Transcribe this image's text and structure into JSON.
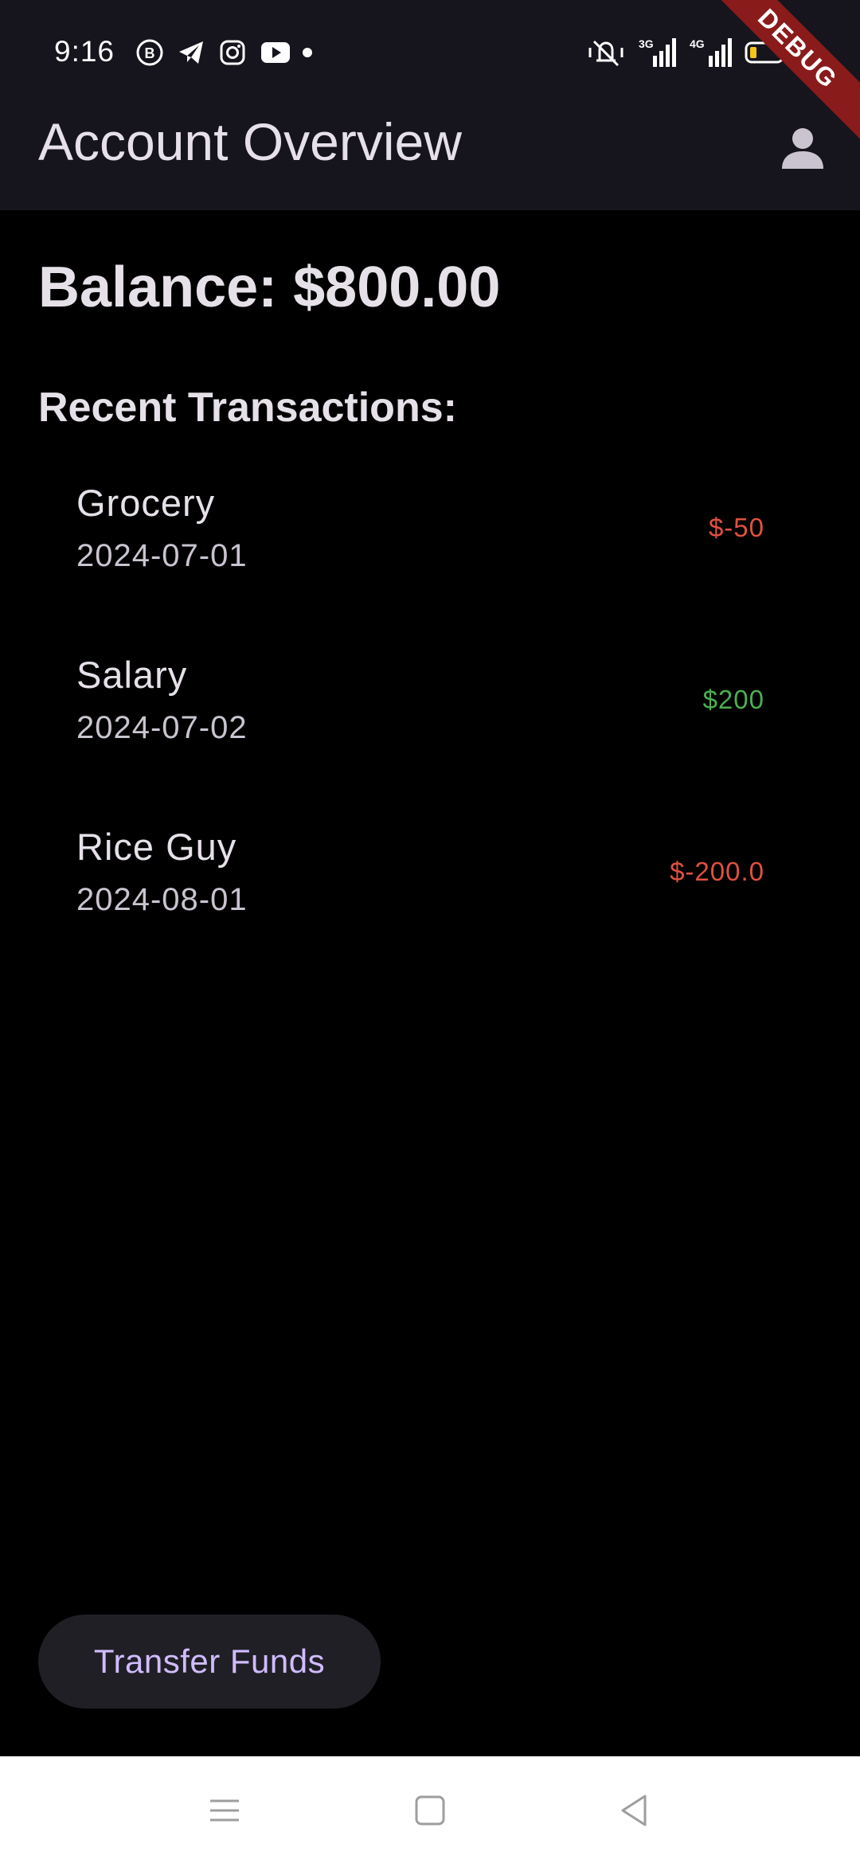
{
  "status_bar": {
    "time": "9:16",
    "notification_icons": [
      "b-icon",
      "telegram-icon",
      "instagram-icon",
      "youtube-icon",
      "dot-icon"
    ],
    "system_icons": [
      "vibrate-icon",
      "signal-3g-icon",
      "signal-4g-icon",
      "battery-icon"
    ],
    "network_labels": [
      "3G",
      "4G"
    ]
  },
  "debug_banner": "DEBUG",
  "app_bar": {
    "title": "Account Overview",
    "profile_icon": "person-icon"
  },
  "balance_text": "Balance: $800.00",
  "recent_heading": "Recent Transactions:",
  "transactions": [
    {
      "title": "Grocery",
      "date": "2024-07-01",
      "amount": "$-50",
      "type": "debit"
    },
    {
      "title": "Salary",
      "date": "2024-07-02",
      "amount": "$200",
      "type": "credit"
    },
    {
      "title": "Rice Guy",
      "date": "2024-08-01",
      "amount": "$-200.0",
      "type": "debit"
    }
  ],
  "transfer_button_label": "Transfer Funds",
  "navigation": [
    "menu-icon",
    "home-icon",
    "back-icon"
  ],
  "colors": {
    "background": "#000000",
    "app_bar": "#16141c",
    "debit": "#e0513f",
    "credit": "#4caf50",
    "button_text": "#d0bcff",
    "button_bg": "#211f26"
  }
}
